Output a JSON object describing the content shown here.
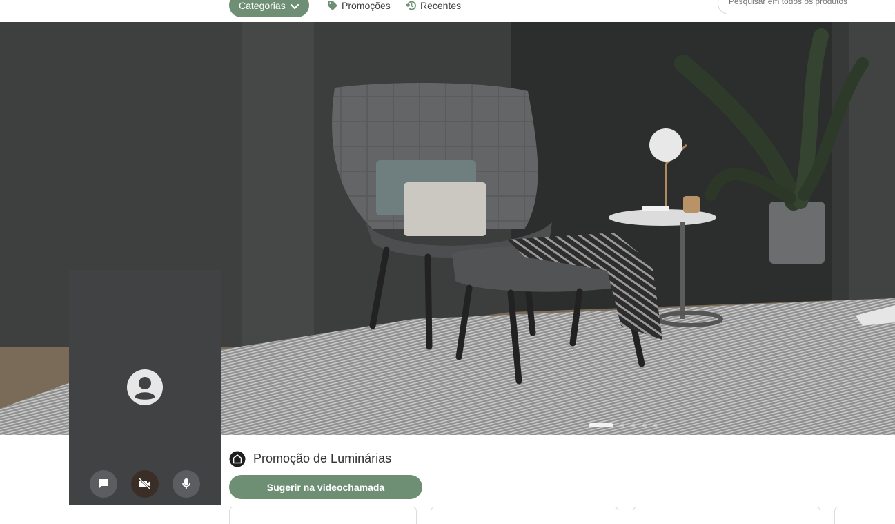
{
  "nav": {
    "categories_label": "Categorias",
    "promotions_label": "Promoções",
    "recent_label": "Recentes",
    "search_placeholder": "Pesquisar em todos os produtos"
  },
  "icons": {
    "categories": "chevron-down-icon",
    "promotions": "tag-icon",
    "recent": "history-icon",
    "video_user": "account-circle-icon",
    "chat": "chat-icon",
    "camera": "video-off-icon",
    "mic": "microphone-icon",
    "section": "home-icon"
  },
  "hero": {
    "slides_total": 5,
    "active_slide": 1
  },
  "section": {
    "title": "Promoção de Luminárias",
    "suggest_label": "Sugerir na videochamada"
  },
  "colors": {
    "accent": "#6e8f74",
    "video_bg": "#414244",
    "camera_off": "#3a2e26"
  }
}
